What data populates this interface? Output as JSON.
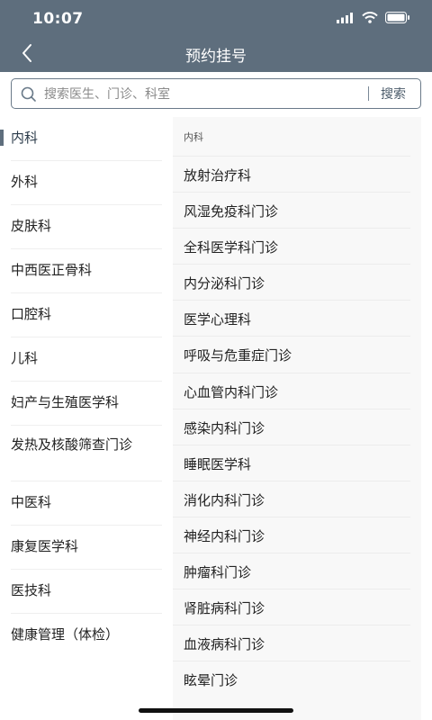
{
  "status": {
    "time": "10:07"
  },
  "nav": {
    "title": "预约挂号"
  },
  "search": {
    "placeholder": "搜索医生、门诊、科室",
    "button": "搜索"
  },
  "colors": {
    "header_bg": "#5e6e7d",
    "right_panel_bg": "#f8f8f8"
  },
  "left_items": [
    {
      "label": "内科",
      "active": true
    },
    {
      "label": "外科"
    },
    {
      "label": "皮肤科"
    },
    {
      "label": "中西医正骨科"
    },
    {
      "label": "口腔科"
    },
    {
      "label": "儿科"
    },
    {
      "label": "妇产与生殖医学科"
    },
    {
      "label": "发热及核酸筛查门诊"
    },
    {
      "label": "中医科"
    },
    {
      "label": "康复医学科"
    },
    {
      "label": "医技科"
    },
    {
      "label": "健康管理（体检）"
    }
  ],
  "right_header": "内科",
  "right_items": [
    "放射治疗科",
    "风湿免疫科门诊",
    "全科医学科门诊",
    "内分泌科门诊",
    "医学心理科",
    "呼吸与危重症门诊",
    "心血管内科门诊",
    "感染内科门诊",
    "睡眠医学科",
    "消化内科门诊",
    "神经内科门诊",
    "肿瘤科门诊",
    "肾脏病科门诊",
    "血液病科门诊",
    "眩晕门诊"
  ]
}
